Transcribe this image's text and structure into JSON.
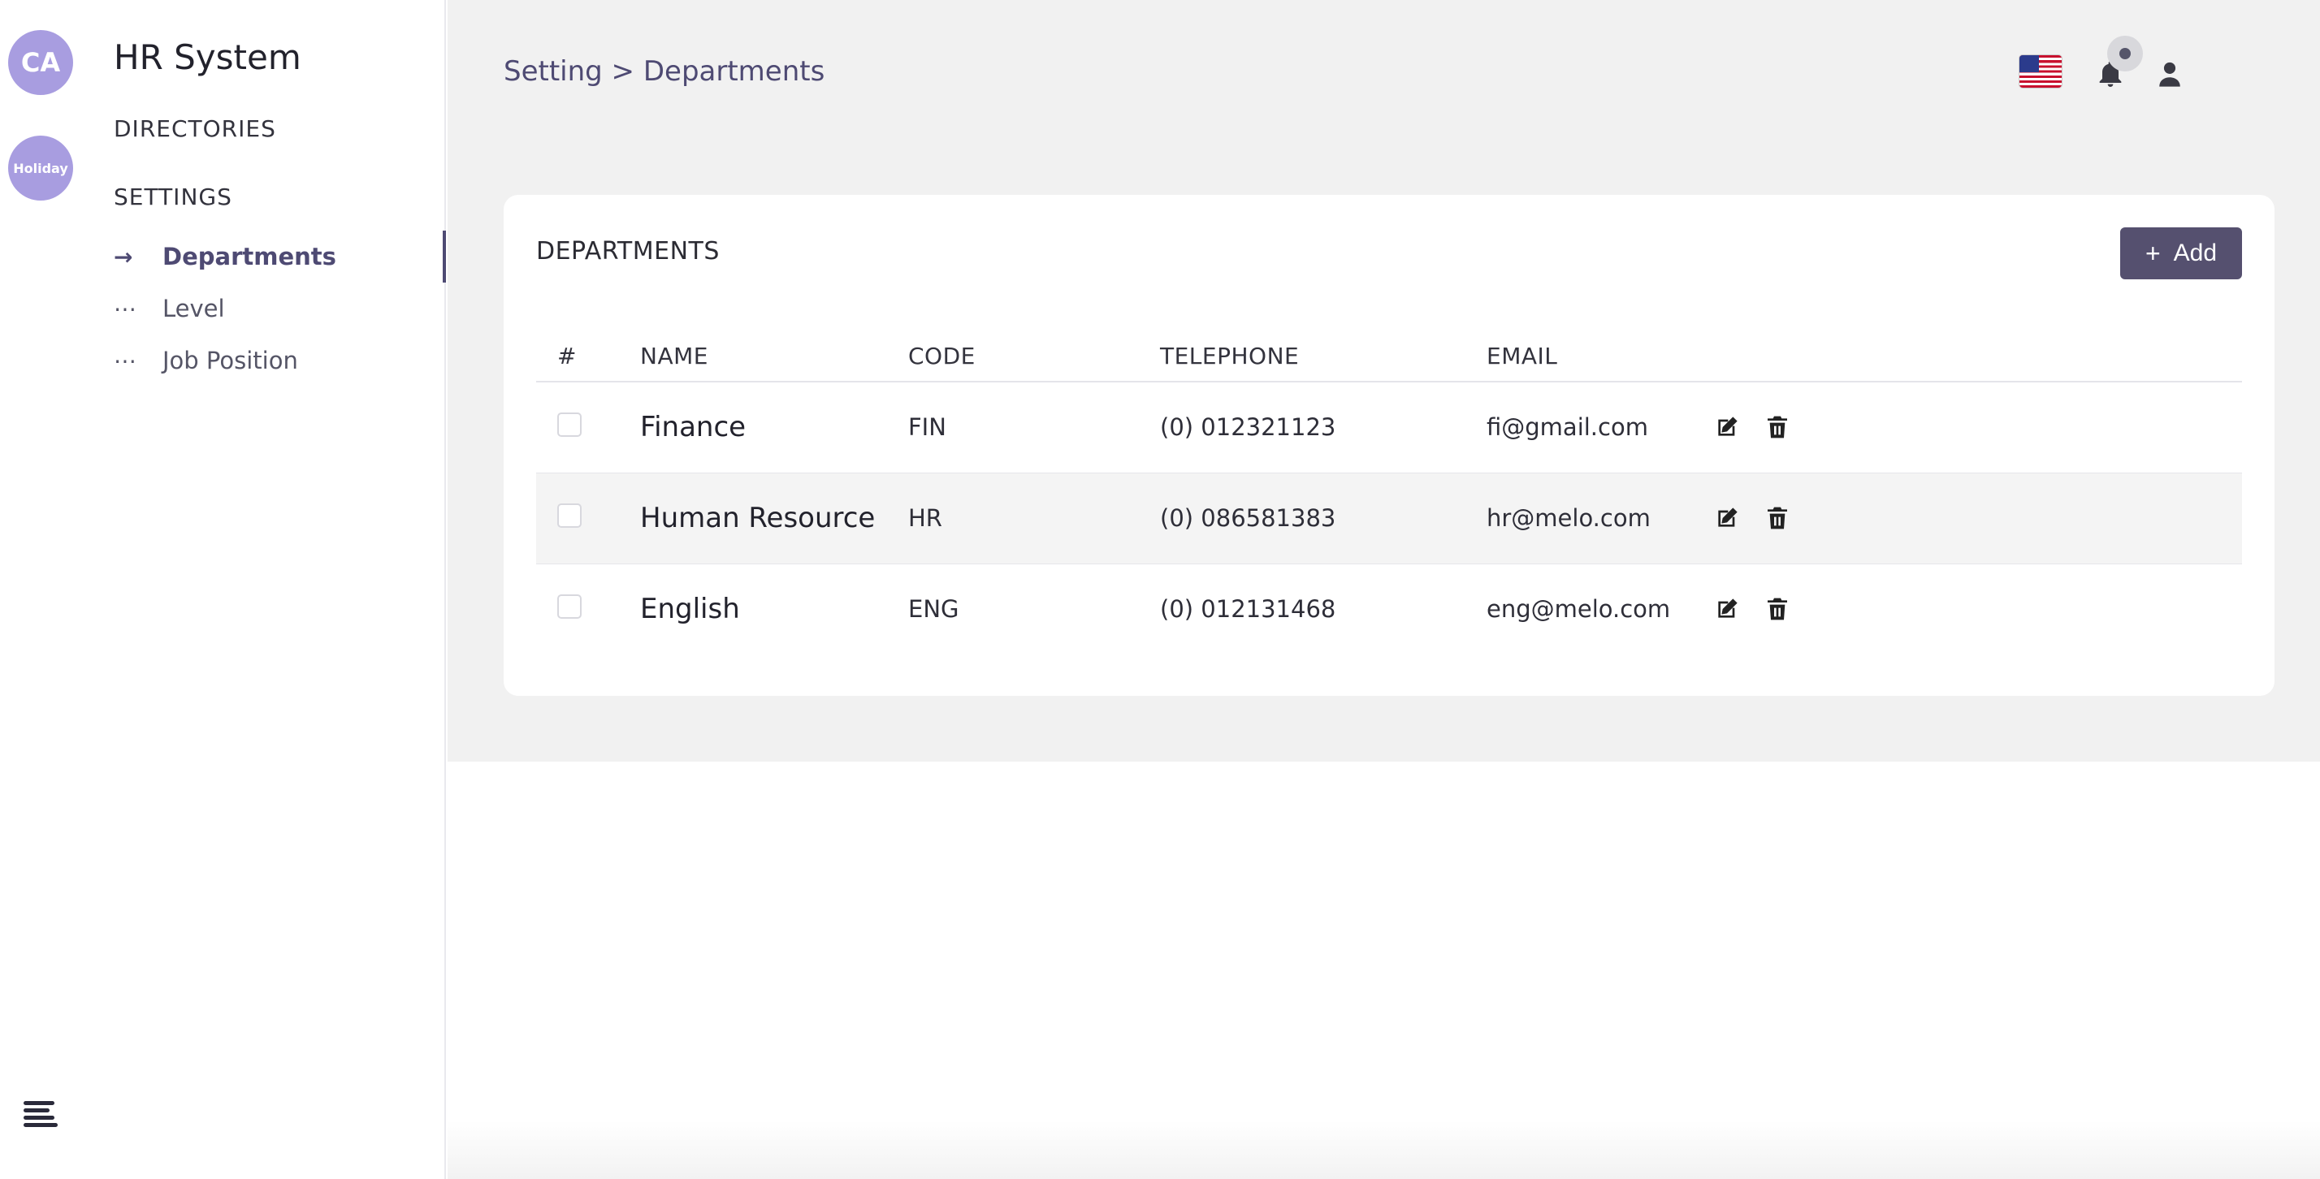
{
  "rail": {
    "avatar_initials": "CA",
    "holiday_label": "Holiday",
    "menu_icon": "hamburger-menu-icon",
    "avatar_color": "#a89de0"
  },
  "sidebar": {
    "brand": "HR System",
    "sections": [
      "DIRECTORIES",
      "SETTINGS"
    ],
    "items": [
      {
        "label": "Departments",
        "marker": "→",
        "active": true
      },
      {
        "label": "Level",
        "marker": "⋯",
        "active": false
      },
      {
        "label": "Job Position",
        "marker": "⋯",
        "active": false
      }
    ]
  },
  "header": {
    "breadcrumb": "Setting > Departments",
    "icons": [
      "us-flag-icon",
      "bell-icon",
      "user-icon"
    ]
  },
  "card": {
    "title": "DEPARTMENTS",
    "add_label": "Add",
    "add_icon": "plus-icon"
  },
  "table": {
    "columns": [
      "#",
      "NAME",
      "CODE",
      "TELEPHONE",
      "EMAIL"
    ],
    "rows": [
      {
        "name": "Finance",
        "code": "FIN",
        "telephone": "(0) 012321123",
        "email": "fi@gmail.com"
      },
      {
        "name": "Human Resource",
        "code": "HR",
        "telephone": "(0) 086581383",
        "email": "hr@melo.com"
      },
      {
        "name": "English",
        "code": "ENG",
        "telephone": "(0) 012131468",
        "email": "eng@melo.com"
      }
    ]
  },
  "colors": {
    "accent": "#4e4a73",
    "button": "#55506f",
    "background": "#f1f1f1"
  }
}
